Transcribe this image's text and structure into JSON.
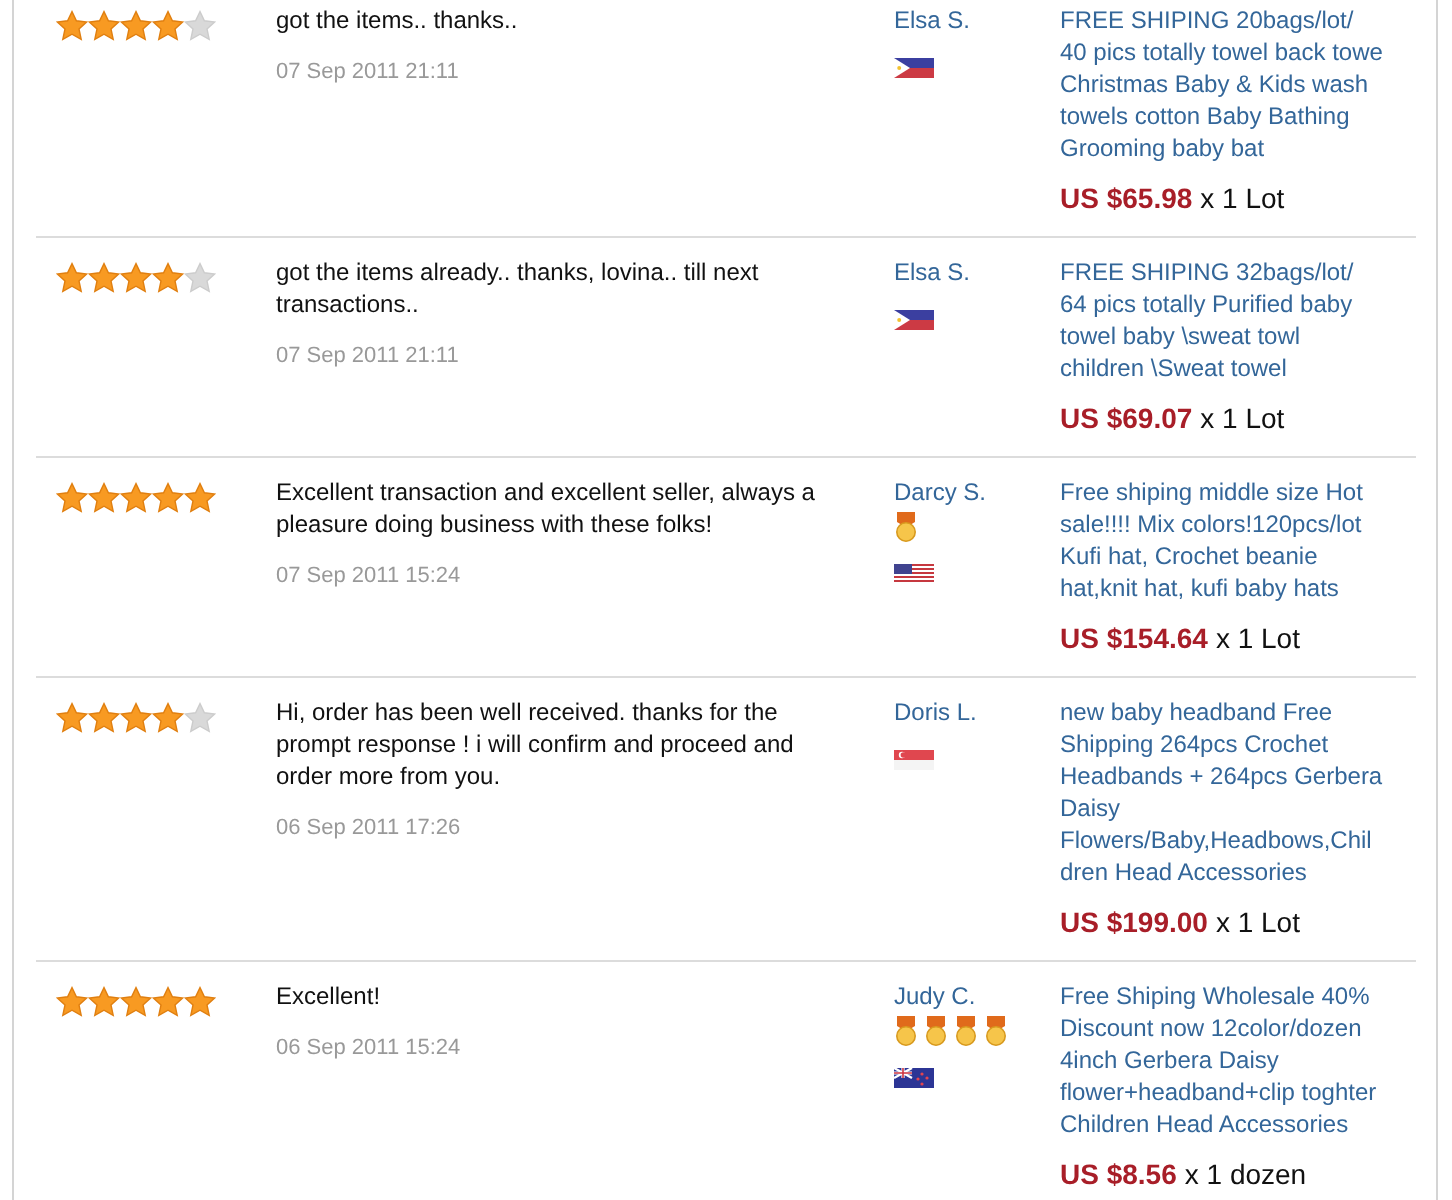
{
  "reviews": [
    {
      "stars": 4,
      "feedback": "got the items.. thanks..",
      "date": "07 Sep 2011 21:11",
      "buyer": {
        "name": "Elsa S.",
        "flag": {
          "kind": "philippines"
        }
      },
      "product": {
        "title": "FREE SHIPING 20bags/lot/ 40 pics totally towel back towe Christmas Baby & Kids wash towels cotton Baby Bathing Grooming baby bat",
        "price": "US $65.98",
        "quantity": "x 1 Lot"
      }
    },
    {
      "stars": 4,
      "feedback": "got the items already.. thanks, lovina.. till next transactions..",
      "date": "07 Sep 2011 21:11",
      "buyer": {
        "name": "Elsa S.",
        "flag": {
          "kind": "philippines"
        }
      },
      "product": {
        "title": "FREE SHIPING 32bags/lot/ 64 pics totally Purified baby towel baby \\sweat towl children \\Sweat towel",
        "price": "US $69.07",
        "quantity": "x 1 Lot"
      }
    },
    {
      "stars": 5,
      "feedback": "Excellent transaction and excellent seller, always a pleasure doing business with these folks!",
      "date": "07 Sep 2011 15:24",
      "buyer": {
        "name": "Darcy S.",
        "medals": [
          {
            "kind": "gold"
          }
        ],
        "flag": {
          "kind": "usa"
        }
      },
      "product": {
        "title": "Free shiping middle size Hot sale!!!! Mix colors!120pcs/lot Kufi hat, Crochet beanie hat,knit hat, kufi baby hats",
        "price": "US $154.64",
        "quantity": "x 1 Lot"
      }
    },
    {
      "stars": 4,
      "feedback": "Hi, order has been well received. thanks for the prompt response ! i will confirm and proceed and order more from you.",
      "date": "06 Sep 2011 17:26",
      "buyer": {
        "name": "Doris L.",
        "flag": {
          "kind": "singapore"
        }
      },
      "product": {
        "title": "new baby headband Free Shipping 264pcs Crochet Headbands + 264pcs Gerbera Daisy Flowers/Baby,Headbows,Children Head Accessories",
        "price": "US $199.00",
        "quantity": "x 1 Lot"
      }
    },
    {
      "stars": 5,
      "feedback": "Excellent!",
      "date": "06 Sep 2011 15:24",
      "buyer": {
        "name": "Judy C.",
        "medals": [
          {
            "kind": "gold"
          },
          {
            "kind": "gold"
          },
          {
            "kind": "gold"
          },
          {
            "kind": "gold"
          }
        ],
        "flag": {
          "kind": "blue-ensign"
        }
      },
      "product": {
        "title": "Free Shiping Wholesale 40% Discount now 12color/dozen 4inch Gerbera Daisy flower+headband+clip toghter Children Head Accessories",
        "price": "US $8.56",
        "quantity": "x 1 dozen"
      }
    }
  ]
}
